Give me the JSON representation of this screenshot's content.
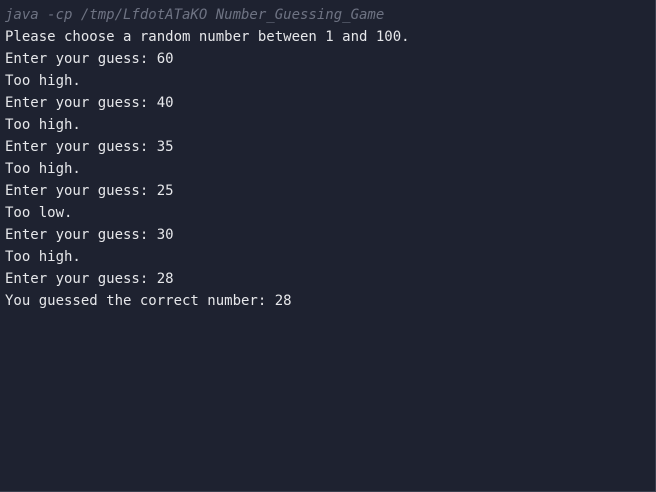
{
  "command": "java -cp /tmp/LfdotATaKO Number_Guessing_Game",
  "output_lines": [
    "Please choose a random number between 1 and 100.",
    "Enter your guess: 60",
    "Too high.",
    "Enter your guess: 40",
    "Too high.",
    "Enter your guess: 35",
    "Too high.",
    "Enter your guess: 25",
    "Too low.",
    "Enter your guess: 30",
    "Too high.",
    "Enter your guess: 28",
    "You guessed the correct number: 28"
  ]
}
